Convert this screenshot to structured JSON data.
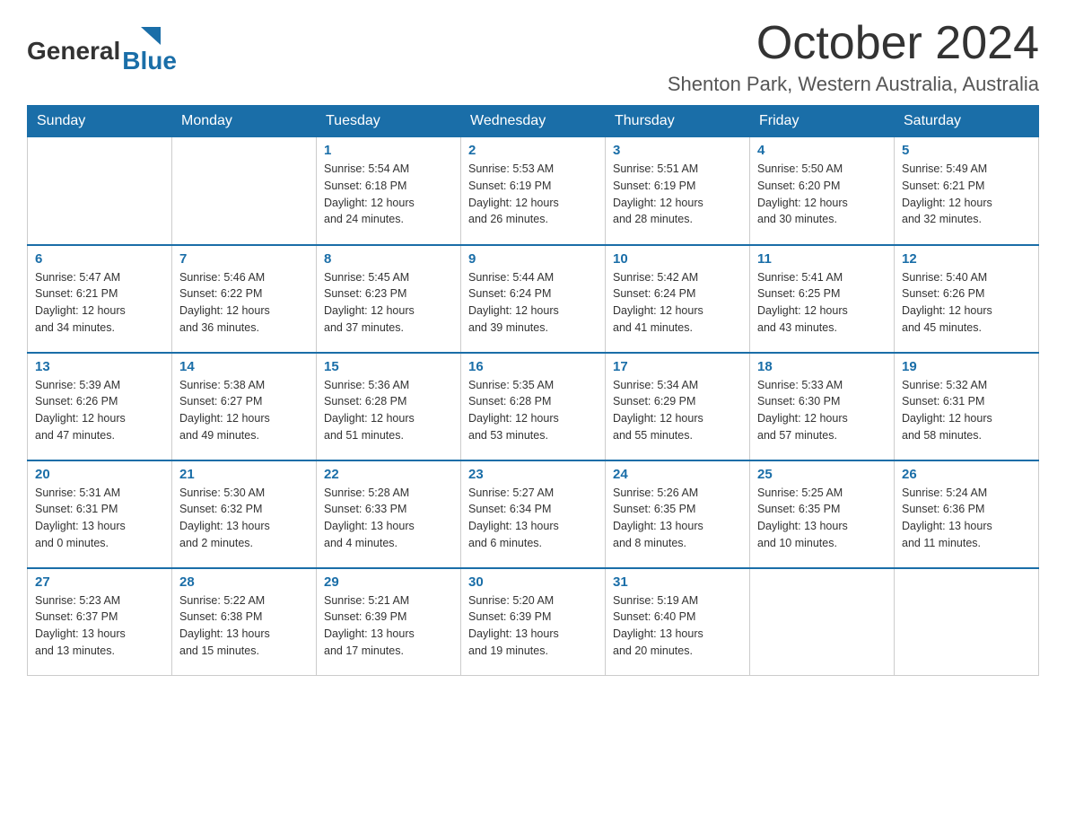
{
  "logo": {
    "general": "General",
    "blue": "Blue"
  },
  "title": "October 2024",
  "location": "Shenton Park, Western Australia, Australia",
  "days_of_week": [
    "Sunday",
    "Monday",
    "Tuesday",
    "Wednesday",
    "Thursday",
    "Friday",
    "Saturday"
  ],
  "weeks": [
    [
      {
        "day": "",
        "info": ""
      },
      {
        "day": "",
        "info": ""
      },
      {
        "day": "1",
        "info": "Sunrise: 5:54 AM\nSunset: 6:18 PM\nDaylight: 12 hours\nand 24 minutes."
      },
      {
        "day": "2",
        "info": "Sunrise: 5:53 AM\nSunset: 6:19 PM\nDaylight: 12 hours\nand 26 minutes."
      },
      {
        "day": "3",
        "info": "Sunrise: 5:51 AM\nSunset: 6:19 PM\nDaylight: 12 hours\nand 28 minutes."
      },
      {
        "day": "4",
        "info": "Sunrise: 5:50 AM\nSunset: 6:20 PM\nDaylight: 12 hours\nand 30 minutes."
      },
      {
        "day": "5",
        "info": "Sunrise: 5:49 AM\nSunset: 6:21 PM\nDaylight: 12 hours\nand 32 minutes."
      }
    ],
    [
      {
        "day": "6",
        "info": "Sunrise: 5:47 AM\nSunset: 6:21 PM\nDaylight: 12 hours\nand 34 minutes."
      },
      {
        "day": "7",
        "info": "Sunrise: 5:46 AM\nSunset: 6:22 PM\nDaylight: 12 hours\nand 36 minutes."
      },
      {
        "day": "8",
        "info": "Sunrise: 5:45 AM\nSunset: 6:23 PM\nDaylight: 12 hours\nand 37 minutes."
      },
      {
        "day": "9",
        "info": "Sunrise: 5:44 AM\nSunset: 6:24 PM\nDaylight: 12 hours\nand 39 minutes."
      },
      {
        "day": "10",
        "info": "Sunrise: 5:42 AM\nSunset: 6:24 PM\nDaylight: 12 hours\nand 41 minutes."
      },
      {
        "day": "11",
        "info": "Sunrise: 5:41 AM\nSunset: 6:25 PM\nDaylight: 12 hours\nand 43 minutes."
      },
      {
        "day": "12",
        "info": "Sunrise: 5:40 AM\nSunset: 6:26 PM\nDaylight: 12 hours\nand 45 minutes."
      }
    ],
    [
      {
        "day": "13",
        "info": "Sunrise: 5:39 AM\nSunset: 6:26 PM\nDaylight: 12 hours\nand 47 minutes."
      },
      {
        "day": "14",
        "info": "Sunrise: 5:38 AM\nSunset: 6:27 PM\nDaylight: 12 hours\nand 49 minutes."
      },
      {
        "day": "15",
        "info": "Sunrise: 5:36 AM\nSunset: 6:28 PM\nDaylight: 12 hours\nand 51 minutes."
      },
      {
        "day": "16",
        "info": "Sunrise: 5:35 AM\nSunset: 6:28 PM\nDaylight: 12 hours\nand 53 minutes."
      },
      {
        "day": "17",
        "info": "Sunrise: 5:34 AM\nSunset: 6:29 PM\nDaylight: 12 hours\nand 55 minutes."
      },
      {
        "day": "18",
        "info": "Sunrise: 5:33 AM\nSunset: 6:30 PM\nDaylight: 12 hours\nand 57 minutes."
      },
      {
        "day": "19",
        "info": "Sunrise: 5:32 AM\nSunset: 6:31 PM\nDaylight: 12 hours\nand 58 minutes."
      }
    ],
    [
      {
        "day": "20",
        "info": "Sunrise: 5:31 AM\nSunset: 6:31 PM\nDaylight: 13 hours\nand 0 minutes."
      },
      {
        "day": "21",
        "info": "Sunrise: 5:30 AM\nSunset: 6:32 PM\nDaylight: 13 hours\nand 2 minutes."
      },
      {
        "day": "22",
        "info": "Sunrise: 5:28 AM\nSunset: 6:33 PM\nDaylight: 13 hours\nand 4 minutes."
      },
      {
        "day": "23",
        "info": "Sunrise: 5:27 AM\nSunset: 6:34 PM\nDaylight: 13 hours\nand 6 minutes."
      },
      {
        "day": "24",
        "info": "Sunrise: 5:26 AM\nSunset: 6:35 PM\nDaylight: 13 hours\nand 8 minutes."
      },
      {
        "day": "25",
        "info": "Sunrise: 5:25 AM\nSunset: 6:35 PM\nDaylight: 13 hours\nand 10 minutes."
      },
      {
        "day": "26",
        "info": "Sunrise: 5:24 AM\nSunset: 6:36 PM\nDaylight: 13 hours\nand 11 minutes."
      }
    ],
    [
      {
        "day": "27",
        "info": "Sunrise: 5:23 AM\nSunset: 6:37 PM\nDaylight: 13 hours\nand 13 minutes."
      },
      {
        "day": "28",
        "info": "Sunrise: 5:22 AM\nSunset: 6:38 PM\nDaylight: 13 hours\nand 15 minutes."
      },
      {
        "day": "29",
        "info": "Sunrise: 5:21 AM\nSunset: 6:39 PM\nDaylight: 13 hours\nand 17 minutes."
      },
      {
        "day": "30",
        "info": "Sunrise: 5:20 AM\nSunset: 6:39 PM\nDaylight: 13 hours\nand 19 minutes."
      },
      {
        "day": "31",
        "info": "Sunrise: 5:19 AM\nSunset: 6:40 PM\nDaylight: 13 hours\nand 20 minutes."
      },
      {
        "day": "",
        "info": ""
      },
      {
        "day": "",
        "info": ""
      }
    ]
  ]
}
